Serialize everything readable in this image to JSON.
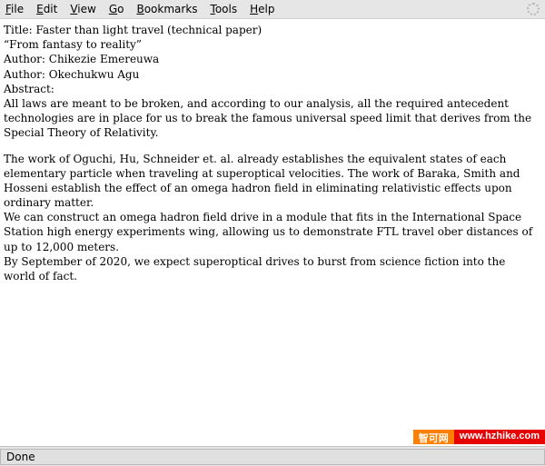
{
  "menu": {
    "items": [
      {
        "key": "F",
        "rest": "ile"
      },
      {
        "key": "E",
        "rest": "dit"
      },
      {
        "key": "V",
        "rest": "iew"
      },
      {
        "key": "G",
        "rest": "o"
      },
      {
        "key": "B",
        "rest": "ookmarks"
      },
      {
        "key": "T",
        "rest": "ools"
      },
      {
        "key": "H",
        "rest": "elp"
      }
    ]
  },
  "doc": {
    "title_line": "Title: Faster than light travel (technical paper)",
    "subtitle": "“From fantasy to reality”",
    "author1": "Author: Chikezie Emereuwa",
    "author2": "Author: Okechukwu Agu",
    "abstract_label": "Abstract:",
    "p1": "All laws are meant to be broken, and according to our analysis, all the required antecedent technologies are in place for us to break the famous universal speed limit that derives from the Special Theory of Relativity.",
    "p2": "The work of Oguchi, Hu, Schneider et. al. already establishes the equivalent states of each elementary particle when traveling at superoptical velocities. The work of Baraka, Smith and Hosseni establish the effect of an omega hadron field in eliminating relativistic effects upon ordinary matter.",
    "p3": "We can construct an omega hadron field drive in a module that fits in the International Space Station high energy experiments wing, allowing us to demonstrate FTL travel ober distances of up to 12,000 meters.",
    "p4": "By September of 2020, we expect superoptical drives to burst from science fiction into the world of fact."
  },
  "status": {
    "text": "Done"
  },
  "watermark": {
    "left": "智可网",
    "right": "www.hzhike.com"
  }
}
